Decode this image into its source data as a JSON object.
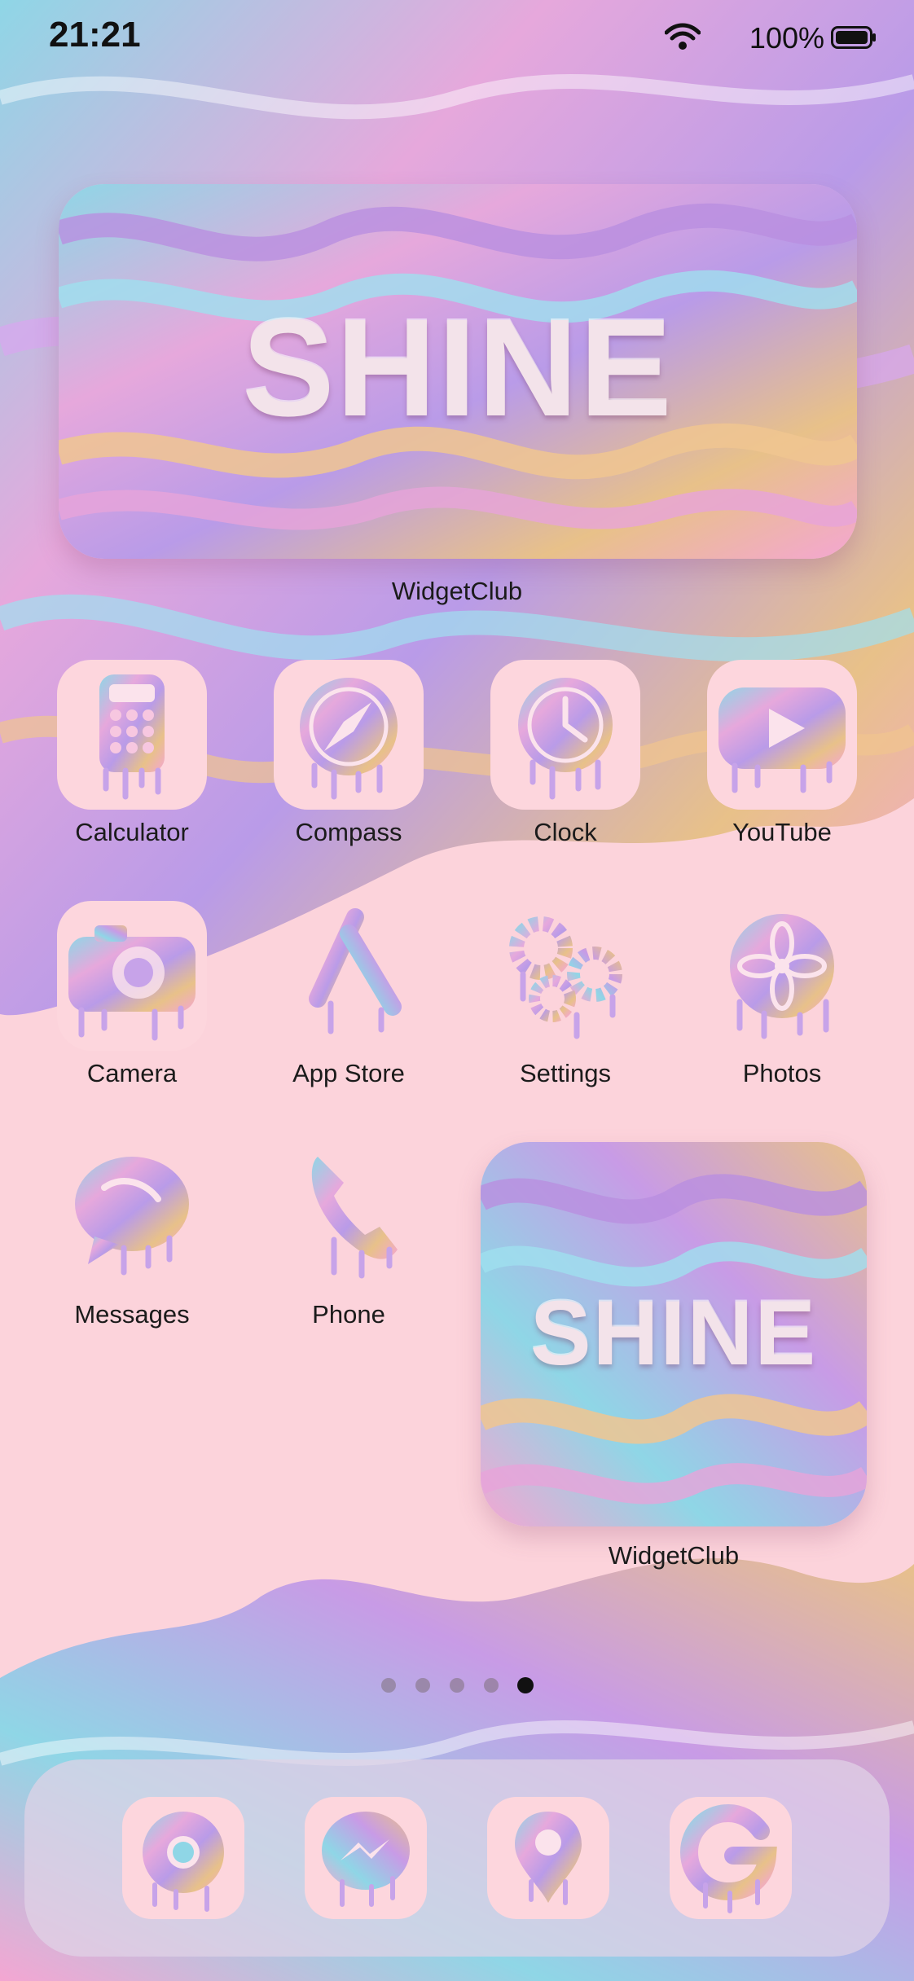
{
  "status_bar": {
    "time": "21:21",
    "battery_percent": "100%"
  },
  "widgets": {
    "top": {
      "text": "SHINE",
      "label": "WidgetClub"
    },
    "bottom": {
      "text": "SHINE",
      "label": "WidgetClub"
    }
  },
  "apps": [
    {
      "label": "Calculator",
      "icon": "calculator-icon"
    },
    {
      "label": "Compass",
      "icon": "compass-icon"
    },
    {
      "label": "Clock",
      "icon": "clock-icon"
    },
    {
      "label": "YouTube",
      "icon": "youtube-icon"
    },
    {
      "label": "Camera",
      "icon": "camera-icon"
    },
    {
      "label": "App Store",
      "icon": "app-store-icon"
    },
    {
      "label": "Settings",
      "icon": "settings-icon"
    },
    {
      "label": "Photos",
      "icon": "photos-icon"
    },
    {
      "label": "Messages",
      "icon": "messages-icon"
    },
    {
      "label": "Phone",
      "icon": "phone-icon"
    }
  ],
  "page_indicator": {
    "pages": 5,
    "current": 5
  },
  "dock": [
    {
      "icon": "chrome-icon"
    },
    {
      "icon": "messenger-icon"
    },
    {
      "icon": "maps-icon"
    },
    {
      "icon": "google-icon"
    }
  ],
  "colors": {
    "background": "#fcd3db",
    "tile": "#fdd6dd",
    "pink": "#f4a6d2",
    "lilac": "#b99be8",
    "aqua": "#8fd6e6",
    "gold": "#e8c189"
  }
}
